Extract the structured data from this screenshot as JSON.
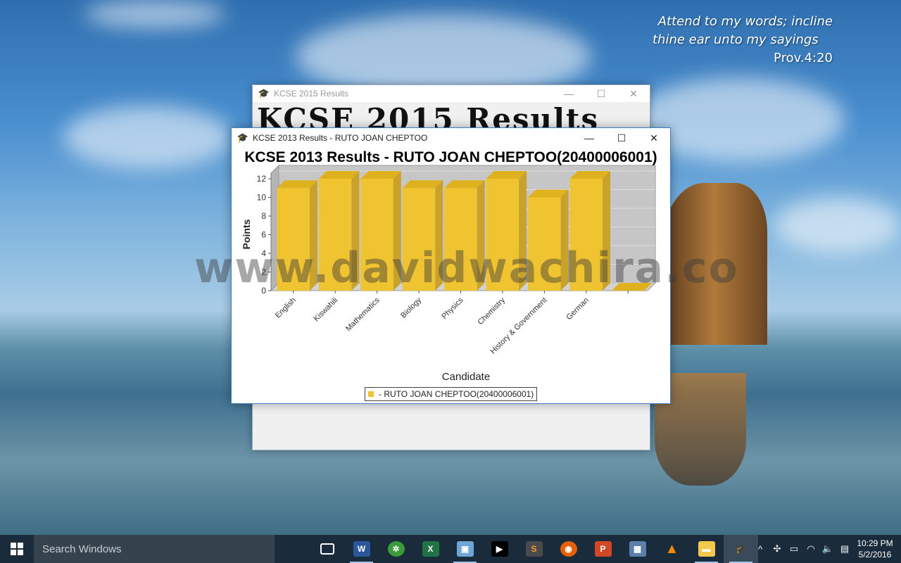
{
  "desktop": {
    "verse": {
      "line1": "Attend to my words; incline",
      "line2": "thine ear unto my sayings",
      "line3": "Prov.4:20"
    },
    "watermark": "www.davidwachira.co"
  },
  "back_window": {
    "title": "KCSE 2015 Results",
    "banner": "KCSE 2015 Results"
  },
  "window": {
    "title": "KCSE 2013 Results - RUTO JOAN CHEPTOO",
    "controls": {
      "minimize": "—",
      "maximize": "☐",
      "close": "✕"
    }
  },
  "chart_data": {
    "type": "bar",
    "title": "KCSE 2013 Results - RUTO JOAN CHEPTOO(20400006001)",
    "xlabel": "Candidate",
    "ylabel": "Points",
    "categories": [
      "English",
      "Kiswahili",
      "Mathematics",
      "Biology",
      "Physics",
      "Chemistry",
      "History & Government",
      "German",
      ""
    ],
    "series": [
      {
        "name": "- RUTO JOAN CHEPTOO(20400006001)",
        "values": [
          11,
          12,
          12,
          11,
          11,
          12,
          10,
          12,
          0
        ]
      }
    ],
    "y_ticks": [
      "0",
      "2",
      "4",
      "6",
      "8",
      "10",
      "12"
    ],
    "ylim": [
      0,
      12.6
    ],
    "bar_color": "#f0c330",
    "grid": true,
    "legend": "bottom"
  },
  "taskbar": {
    "search_placeholder": "Search Windows",
    "apps": [
      "task-view",
      "word",
      "network-app",
      "excel",
      "virtualbox",
      "media-player",
      "sublime",
      "firefox",
      "powerpoint",
      "photos",
      "vlc",
      "file-explorer",
      "java-app"
    ],
    "clock": {
      "time": "10:29 PM",
      "date": "5/2/2016"
    }
  }
}
